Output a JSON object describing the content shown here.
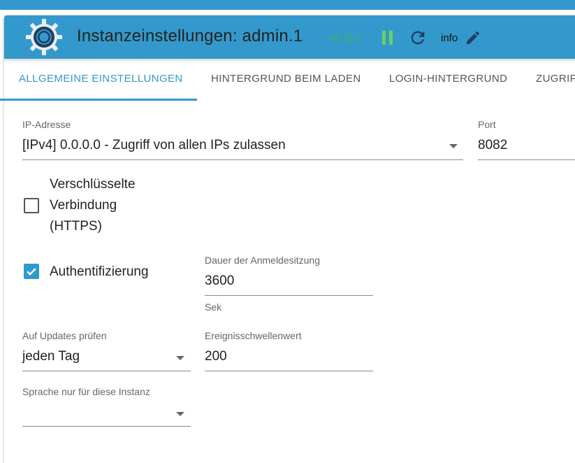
{
  "header": {
    "title": "Instanzeinstellungen: admin.1",
    "version": "v6.10.1",
    "info_label": "info",
    "logo_icon": "iobroker-gear-logo",
    "pause_icon": "pause-icon",
    "reload_icon": "reload-icon",
    "edit_icon": "pencil-icon",
    "accent_color": "#3399cc",
    "running_color": "#6ccf63"
  },
  "tabs": [
    {
      "label": "ALLGEMEINE EINSTELLUNGEN",
      "active": true
    },
    {
      "label": "HINTERGRUND BEIM LADEN",
      "active": false
    },
    {
      "label": "LOGIN-HINTERGRUND",
      "active": false
    },
    {
      "label": "ZUGRIF",
      "active": false
    }
  ],
  "form": {
    "ip": {
      "label": "IP-Adresse",
      "value": "[IPv4] 0.0.0.0 - Zugriff von allen IPs zulassen"
    },
    "port": {
      "label": "Port",
      "value": "8082"
    },
    "https": {
      "label_lines": [
        "Verschlüsselte",
        "Verbindung",
        "(HTTPS)"
      ],
      "checked": false
    },
    "auth": {
      "label": "Authentifizierung",
      "checked": true
    },
    "session": {
      "label": "Dauer der Anmeldesitzung",
      "value": "3600",
      "unit": "Sek"
    },
    "updates": {
      "label": "Auf Updates prüfen",
      "value": "jeden Tag"
    },
    "threshold": {
      "label": "Ereignisschwellenwert",
      "value": "200"
    },
    "language": {
      "label": "Sprache nur für diese Instanz",
      "value": ""
    }
  }
}
